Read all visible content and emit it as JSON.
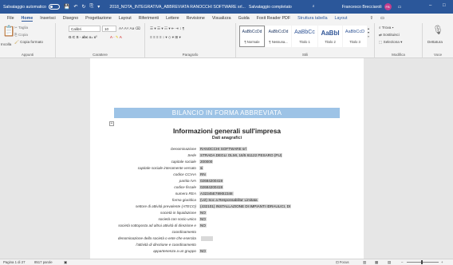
{
  "titlebar": {
    "autosave_label": "Salvataggio automatico",
    "autosave_state": "off",
    "document_name": "2018_NOTA_INTEGRATIVA_ABBREVIATA RANOCCHI SOFTWARE srl...",
    "save_status": "Salvataggio completato",
    "user_name": "Francesco Brecciaroli",
    "user_initials": "FB",
    "accent_color": "#2b579a"
  },
  "tabs": [
    "File",
    "Home",
    "Inserisci",
    "Disegno",
    "Progettazione",
    "Layout",
    "Riferimenti",
    "Lettere",
    "Revisione",
    "Visualizza",
    "Guida",
    "Foxit Reader PDF",
    "Struttura tabella",
    "Layout"
  ],
  "active_tab": "Home",
  "ribbon": {
    "clipboard": {
      "paste": "Incolla",
      "cut": "Taglia",
      "copy": "Copia",
      "format_painter": "Copia formato",
      "group_label": "Appunti"
    },
    "font": {
      "font_name": "Calibri",
      "font_size": "10",
      "style_buttons": "G  C  S  ·  abc  x₂  x²",
      "group_label": "Carattere"
    },
    "paragraph": {
      "group_label": "Paragrafo"
    },
    "styles": {
      "items": [
        {
          "sample": "AaBbCcDd",
          "name": "¶ Normale"
        },
        {
          "sample": "AaBbCcDd",
          "name": "¶ Nessuna..."
        },
        {
          "sample": "AaBbCc",
          "name": "Titolo 1"
        },
        {
          "sample": "AaBbl",
          "name": "Titolo 2"
        },
        {
          "sample": "AaBbCcD",
          "name": "Titolo 3"
        }
      ],
      "group_label": "Stili"
    },
    "editing": {
      "find": "Trova",
      "replace": "Sostituisci",
      "select": "Seleziona",
      "group_label": "Modifica"
    },
    "voice": {
      "dictate": "Dettatura",
      "group_label": "Voce"
    }
  },
  "document": {
    "banner": "BILANCIO IN FORMA ABBREVIATA",
    "heading": "Informazioni generali sull'impresa",
    "subheading": "Dati anagrafici",
    "rows": [
      {
        "label": "Denominazione",
        "value": "RANOCCHI SOFTWARE srl"
      },
      {
        "label": "Sede",
        "value": "STRADA DEGLI OLMI, 16/5 61122 PESARO (PU)"
      },
      {
        "label": "capitale sociale",
        "value": "200000"
      },
      {
        "label": "capitale sociale interamente versato",
        "value": "si"
      },
      {
        "label": "codice CCIAA",
        "value": "RN"
      },
      {
        "label": "partita IVA",
        "value": "02684200419"
      },
      {
        "label": "codice fiscale",
        "value": "02684200419"
      },
      {
        "label": "numero REA",
        "value": "A32345E7890I2348"
      },
      {
        "label": "forma giuridica",
        "value": "(U2) Soc a Responsabilita' Limitata"
      },
      {
        "label": "settore di attività prevalente (ATECO)",
        "value": "(432101) INSTALLAZIONE DI IMPIANTI IDRAULICI, DI"
      },
      {
        "label": "società in liquidazione",
        "value": "NO"
      },
      {
        "label": "società con socio unico",
        "value": "NO"
      },
      {
        "label": "società sottoposta ad altrui attività di direzione e",
        "value": "NO"
      },
      {
        "label": "coordinamento",
        "value": ""
      },
      {
        "label": "denominazione della società o ente che esercita",
        "value": ""
      },
      {
        "label": "l'attività di direzione e coordinamento",
        "value": ""
      },
      {
        "label": "appartenenza a un gruppo",
        "value": "NO"
      }
    ]
  },
  "status": {
    "page": "Pagina 1 di 27",
    "words": "8517 parole",
    "focus": "Focus"
  }
}
